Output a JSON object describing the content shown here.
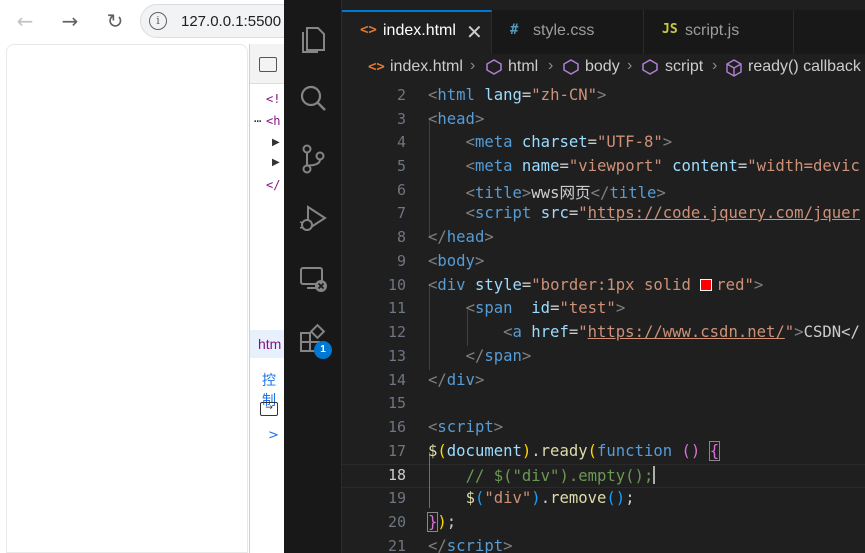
{
  "browser": {
    "address": "127.0.0.1:5500",
    "devtools": {
      "doctype_partial": "<!",
      "html_partial": "<h",
      "close_partial": "</",
      "selected_tag": "htm",
      "console_label": "控制",
      "prompt": ">"
    }
  },
  "editor": {
    "tabs": [
      {
        "icon": "<>",
        "label": "index.html",
        "active": true,
        "close": "✕"
      },
      {
        "icon": "#",
        "label": "style.css",
        "active": false
      },
      {
        "icon": "JS",
        "label": "script.js",
        "active": false
      }
    ],
    "breadcrumb": [
      "index.html",
      "html",
      "body",
      "script",
      "ready() callback"
    ],
    "extensions_badge": "1",
    "current_line": 18,
    "lines": [
      {
        "n": "2"
      },
      {
        "n": "3"
      },
      {
        "n": "4"
      },
      {
        "n": "5"
      },
      {
        "n": "6"
      },
      {
        "n": "7"
      },
      {
        "n": "8"
      },
      {
        "n": "9"
      },
      {
        "n": "10"
      },
      {
        "n": "11"
      },
      {
        "n": "12"
      },
      {
        "n": "13"
      },
      {
        "n": "14"
      },
      {
        "n": "15"
      },
      {
        "n": "16"
      },
      {
        "n": "17"
      },
      {
        "n": "18"
      },
      {
        "n": "19"
      },
      {
        "n": "20"
      },
      {
        "n": "21"
      }
    ],
    "code": {
      "l2": {
        "tag": "html",
        "attr": "lang",
        "val": "\"zh-CN\""
      },
      "l3": {
        "tag": "head"
      },
      "l4": {
        "tag": "meta",
        "attr": "charset",
        "val": "\"UTF-8\""
      },
      "l5": {
        "tag": "meta",
        "attr1": "name",
        "val1": "\"viewport\"",
        "attr2": "content",
        "val2": "\"width=devic"
      },
      "l6": {
        "tag": "title",
        "text": "wws网页"
      },
      "l7": {
        "tag": "script",
        "attr": "src",
        "val_q": "\"",
        "url": "https://code.jquery.com/jquer"
      },
      "l8": {
        "tag": "head"
      },
      "l9": {
        "tag": "body"
      },
      "l10": {
        "tag": "div",
        "attr": "style",
        "val_a": "\"border:1px solid ",
        "val_b": "red\""
      },
      "l11": {
        "tag": "span",
        "attr": "id",
        "val": "\"test\""
      },
      "l12": {
        "tag": "a",
        "attr": "href",
        "val_q": "\"",
        "url": "https://www.csdn.net/",
        "val_q2": "\"",
        "text": "CSDN</"
      },
      "l13": {
        "tag": "span"
      },
      "l14": {
        "tag": "div"
      },
      "l16": {
        "tag": "script"
      },
      "l17": {
        "dollar": "$",
        "obj": "document",
        "method": "ready",
        "kw": "function"
      },
      "l18": {
        "comment": "// $(\"div\").empty();"
      },
      "l19": {
        "dollar": "$",
        "str": "\"div\"",
        "method": "remove"
      },
      "l20": {
        "close": "});"
      },
      "l21": {
        "tag": "script"
      }
    }
  }
}
